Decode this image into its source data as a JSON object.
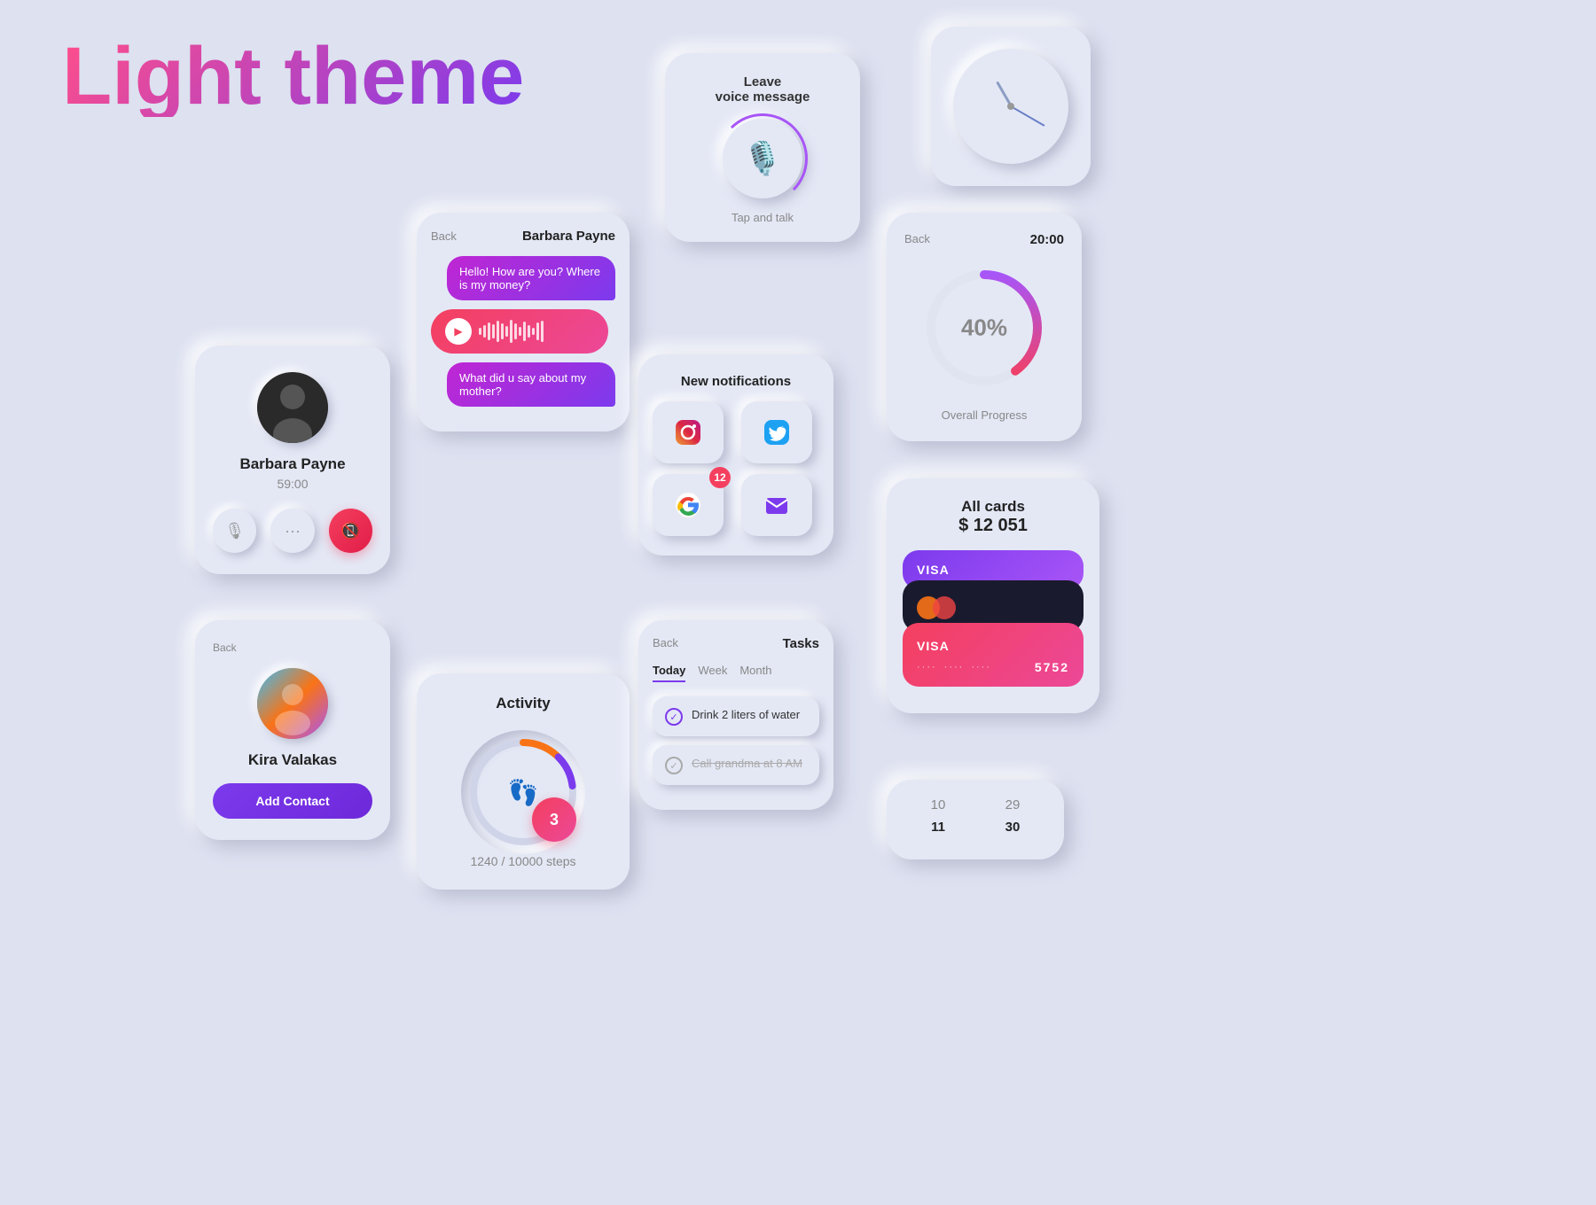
{
  "page": {
    "title": "Light theme",
    "background": "#dde1f0"
  },
  "voice_card": {
    "title_line1": "Leave",
    "title_line2": "voice message",
    "tap_label": "Tap and talk"
  },
  "clock": {
    "label": "Clock"
  },
  "chat": {
    "back_label": "Back",
    "contact_name": "Barbara Payne",
    "bubble1": "Hello! How are you? Where is my money?",
    "bubble3": "What did u say about my mother?",
    "wave_heights": [
      8,
      14,
      20,
      16,
      22,
      18,
      12,
      24,
      16,
      10,
      20,
      14,
      8,
      18,
      22
    ]
  },
  "call_barbara": {
    "name": "Barbara Payne",
    "time": "59:00"
  },
  "contact_kira": {
    "name": "Kira Valakas",
    "add_label": "Add Contact"
  },
  "activity": {
    "title": "Activity",
    "steps_current": "1240",
    "steps_total": "10000",
    "steps_label": "1240 / 10000 steps",
    "ring_progress": 12
  },
  "notifications": {
    "title": "New notifications",
    "badge_count": "12",
    "icons": [
      "instagram",
      "twitter",
      "google",
      "mail"
    ]
  },
  "progress": {
    "back_label": "Back",
    "time": "20:00",
    "percent": "40%",
    "label": "Overall Progress",
    "value": 40
  },
  "tasks": {
    "back_label": "Back",
    "title": "Tasks",
    "tabs": [
      "Today",
      "Week",
      "Month"
    ],
    "active_tab": "Today",
    "items": [
      {
        "text": "Drink 2 liters of water",
        "done": false,
        "strikethrough": false
      },
      {
        "text": "Call grandma at 8 AM",
        "done": true,
        "strikethrough": true
      }
    ]
  },
  "all_cards": {
    "title": "All cards",
    "amount": "$ 12 051",
    "cards": [
      {
        "type": "visa",
        "color": "purple",
        "label": "VISA"
      },
      {
        "type": "mastercard",
        "color": "dark"
      },
      {
        "type": "visa",
        "color": "red",
        "label": "VISA",
        "dots": "····  ····  ····",
        "number": "5752"
      }
    ]
  },
  "calendar": {
    "numbers": [
      [
        "10",
        "29"
      ],
      [
        "11",
        "30"
      ]
    ]
  },
  "bottom_badge": {
    "count": "3"
  }
}
